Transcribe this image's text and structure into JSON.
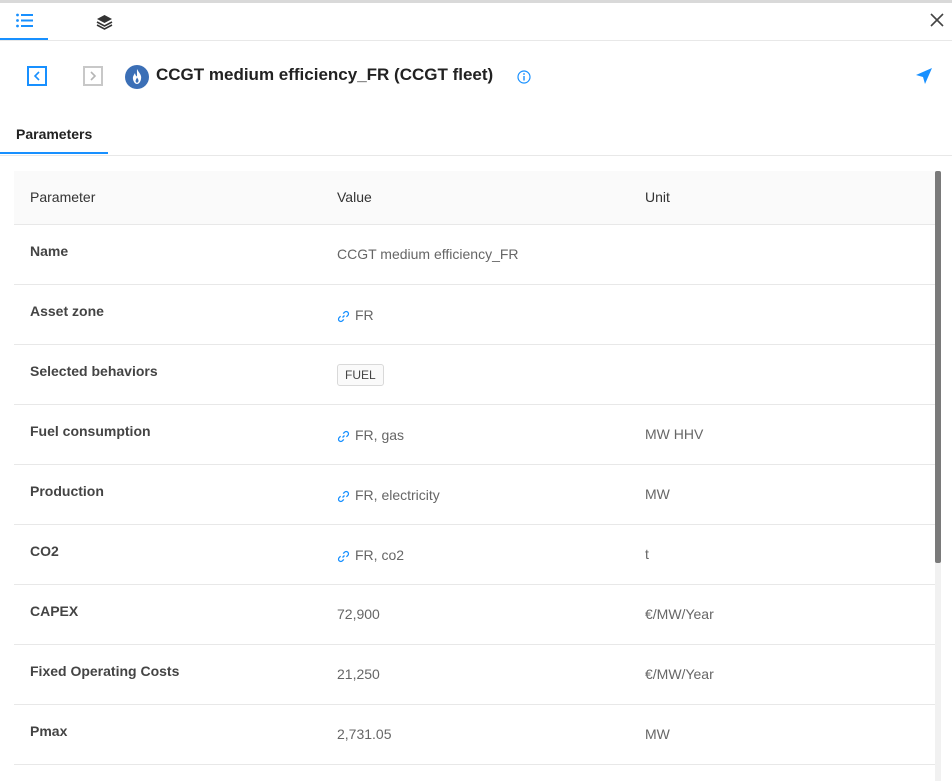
{
  "header": {
    "title": "CCGT medium efficiency_FR (CCGT fleet)"
  },
  "tabs": [
    {
      "label": "Parameters"
    }
  ],
  "table": {
    "columns": [
      "Parameter",
      "Value",
      "Unit"
    ],
    "rows": [
      {
        "name": "Name",
        "value": "CCGT medium efficiency_FR",
        "unit": "",
        "link": false,
        "tag": false
      },
      {
        "name": "Asset zone",
        "value": "FR",
        "unit": "",
        "link": true,
        "tag": false
      },
      {
        "name": "Selected behaviors",
        "value": "FUEL",
        "unit": "",
        "link": false,
        "tag": true
      },
      {
        "name": "Fuel consumption",
        "value": "FR, gas",
        "unit": "MW HHV",
        "link": true,
        "tag": false
      },
      {
        "name": "Production",
        "value": "FR, electricity",
        "unit": "MW",
        "link": true,
        "tag": false
      },
      {
        "name": "CO2",
        "value": "FR, co2",
        "unit": "t",
        "link": true,
        "tag": false
      },
      {
        "name": "CAPEX",
        "value": "72,900",
        "unit": "€/MW/Year",
        "link": false,
        "tag": false
      },
      {
        "name": "Fixed Operating Costs",
        "value": "21,250",
        "unit": "€/MW/Year",
        "link": false,
        "tag": false
      },
      {
        "name": "Pmax",
        "value": "2,731.05",
        "unit": "MW",
        "link": false,
        "tag": false
      }
    ]
  },
  "colors": {
    "accent": "#1890ff",
    "asset_icon_bg": "#3b6fb6"
  },
  "icons": {
    "list_tab": "list-icon",
    "layers_tab": "layers-icon",
    "close": "close-icon",
    "prev": "chevron-left-icon",
    "next": "chevron-right-icon",
    "asset": "gas-flame-icon",
    "info": "info-icon",
    "locate": "locate-arrow-icon",
    "link": "link-icon"
  }
}
